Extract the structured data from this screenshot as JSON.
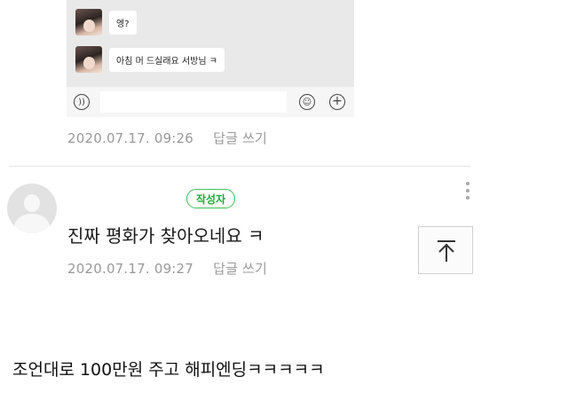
{
  "chat": {
    "messages": [
      {
        "text": "엥?"
      },
      {
        "text": "아침 머 드실래요 서방님 ㅋ"
      }
    ],
    "icons": [
      "voice-icon",
      "emoji-icon",
      "plus-icon"
    ]
  },
  "comment_prev": {
    "date": "2020.07.17. 09:26",
    "reply_label": "답글 쓰기"
  },
  "comment": {
    "author_badge": "작성자",
    "text": "진짜 평화가 찾아오네요 ㅋ",
    "date": "2020.07.17. 09:27",
    "reply_label": "답글 쓰기",
    "more_icon": "more-vertical-icon"
  },
  "top_button": {
    "icon": "arrow-up-to-top-icon"
  },
  "caption": {
    "text": "조언대로 100만원 주고 해피엔딩ㅋㅋㅋㅋㅋ"
  },
  "colors": {
    "badge_green": "#3fbf57",
    "meta_gray": "#9a9a9a",
    "chat_bg": "#e9e9e9"
  }
}
